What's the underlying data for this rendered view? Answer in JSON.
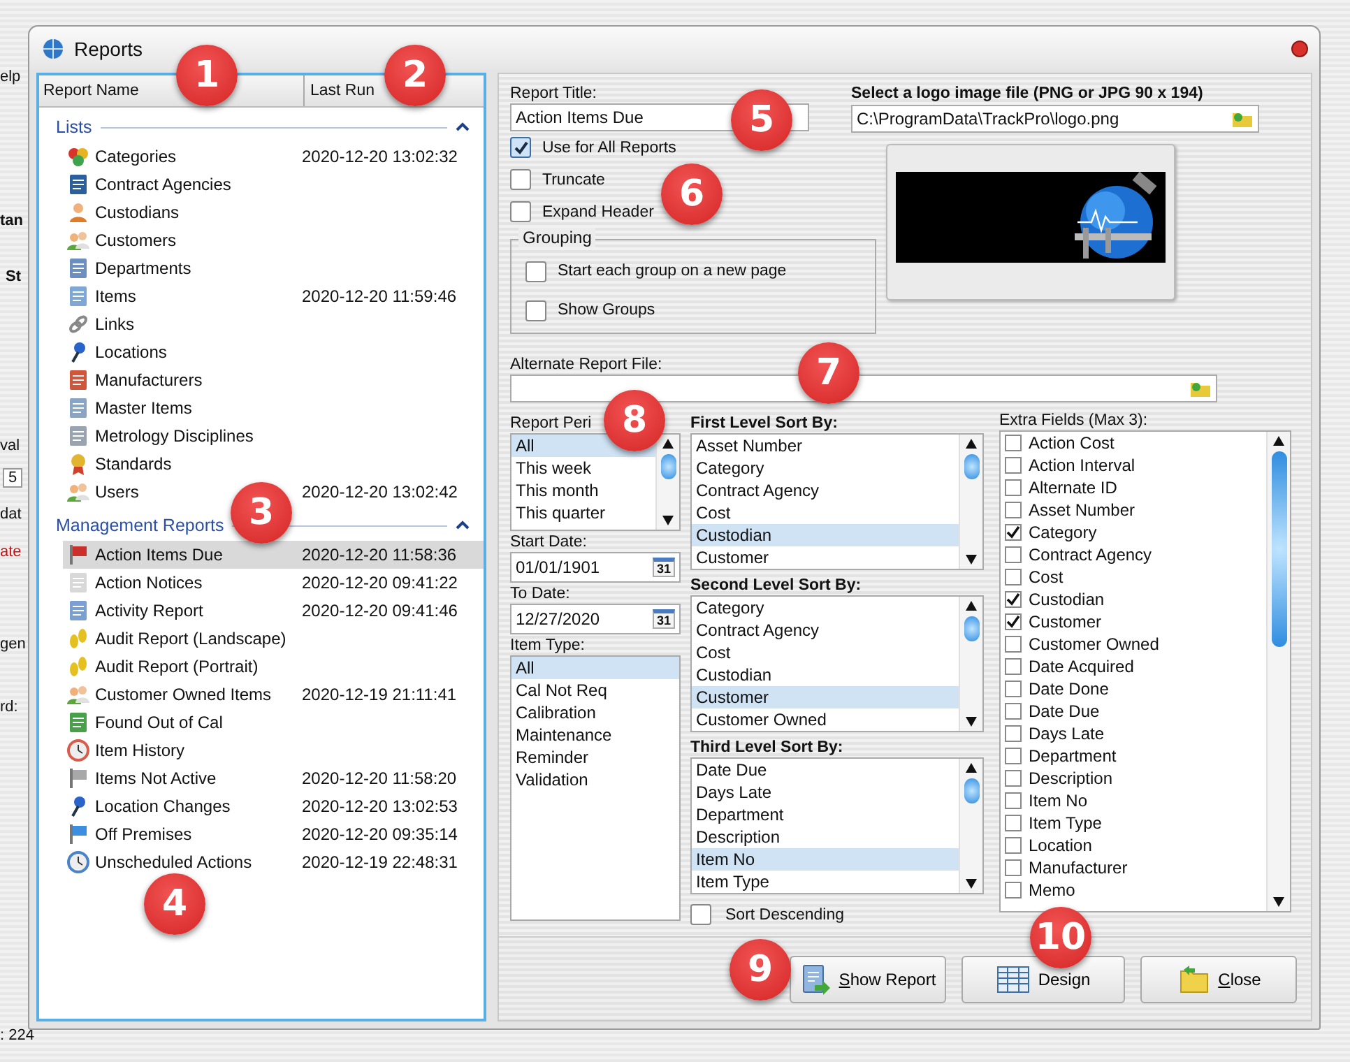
{
  "background": {
    "fragments": [
      {
        "text": "elp",
        "kind": "menu"
      },
      {
        "text": "tan",
        "kind": "heading"
      },
      {
        "text": "St",
        "kind": "heading"
      },
      {
        "text": "val",
        "kind": "label"
      },
      {
        "text": "5",
        "kind": "value"
      },
      {
        "text": "dat",
        "kind": "label"
      },
      {
        "text": "ate",
        "kind": "alert"
      },
      {
        "text": "gen",
        "kind": "label"
      },
      {
        "text": "rd:",
        "kind": "label"
      },
      {
        "text": ": 224",
        "kind": "status"
      }
    ]
  },
  "window": {
    "title": "Reports"
  },
  "report_list": {
    "columns": [
      "Report Name",
      "Last Run"
    ],
    "groups": [
      {
        "title": "Lists",
        "expanded": true,
        "items": [
          {
            "name": "Categories",
            "last_run": "2020-12-20 13:02:32",
            "selected": false
          },
          {
            "name": "Contract Agencies",
            "selected": false
          },
          {
            "name": "Custodians",
            "selected": false
          },
          {
            "name": "Customers",
            "selected": false
          },
          {
            "name": "Departments",
            "selected": false
          },
          {
            "name": "Items",
            "last_run": "2020-12-20 11:59:46",
            "selected": false
          },
          {
            "name": "Links",
            "selected": false
          },
          {
            "name": "Locations",
            "selected": false
          },
          {
            "name": "Manufacturers",
            "selected": false
          },
          {
            "name": "Master Items",
            "selected": false
          },
          {
            "name": "Metrology Disciplines",
            "selected": false
          },
          {
            "name": "Standards",
            "selected": false
          },
          {
            "name": "Users",
            "last_run": "2020-12-20 13:02:42",
            "selected": false
          }
        ]
      },
      {
        "title": "Management Reports",
        "expanded": true,
        "items": [
          {
            "name": "Action Items Due",
            "last_run": "2020-12-20 11:58:36",
            "selected": true
          },
          {
            "name": "Action Notices",
            "last_run": "2020-12-20 09:41:22",
            "selected": false
          },
          {
            "name": "Activity Report",
            "last_run": "2020-12-20 09:41:46",
            "selected": false
          },
          {
            "name": "Audit Report (Landscape)",
            "selected": false
          },
          {
            "name": "Audit Report (Portrait)",
            "selected": false
          },
          {
            "name": "Customer Owned Items",
            "last_run": "2020-12-19 21:11:41",
            "selected": false
          },
          {
            "name": "Found Out of Cal",
            "selected": false
          },
          {
            "name": "Item History",
            "selected": false
          },
          {
            "name": "Items Not Active",
            "last_run": "2020-12-20 11:58:20",
            "selected": false
          },
          {
            "name": "Location Changes",
            "last_run": "2020-12-20 13:02:53",
            "selected": false
          },
          {
            "name": "Off Premises",
            "last_run": "2020-12-20 09:35:14",
            "selected": false
          },
          {
            "name": "Unscheduled Actions",
            "last_run": "2020-12-19 22:48:31",
            "selected": false
          }
        ]
      }
    ]
  },
  "report_title": {
    "label": "Report Title:",
    "value": "Action Items Due"
  },
  "options": [
    {
      "label": "Use for All Reports",
      "checked": true
    },
    {
      "label": "Truncate",
      "checked": false
    },
    {
      "label": "Expand Header",
      "checked": false
    }
  ],
  "grouping": {
    "title": "Grouping",
    "options": [
      {
        "label": "Start each group on a new page",
        "checked": false
      },
      {
        "label": "Show Groups",
        "checked": false
      }
    ]
  },
  "logo": {
    "label": "Select a logo image file (PNG or JPG 90 x 194)",
    "path": "C:\\ProgramData\\TrackPro\\logo.png"
  },
  "alternate_report_file": {
    "label": "Alternate Report File:"
  },
  "report_period": {
    "label": "Report Peri",
    "items": [
      {
        "text": "All",
        "selected": true
      },
      {
        "text": "This week",
        "selected": false
      },
      {
        "text": "This month",
        "selected": false
      },
      {
        "text": "This quarter",
        "selected": false
      }
    ]
  },
  "dates": [
    {
      "label": "Start Date:",
      "value": "01/01/1901",
      "calendar": "31"
    },
    {
      "label": "To Date:",
      "value": "12/27/2020",
      "calendar": "31"
    }
  ],
  "item_type": {
    "label": "Item Type:",
    "items": [
      {
        "text": "All",
        "selected": true
      },
      {
        "text": "Cal Not Req",
        "selected": false
      },
      {
        "text": "Calibration",
        "selected": false
      },
      {
        "text": "Maintenance",
        "selected": false
      },
      {
        "text": "Reminder",
        "selected": false
      },
      {
        "text": "Validation",
        "selected": false
      }
    ]
  },
  "sorts": [
    {
      "label": "First Level Sort By:",
      "items": [
        {
          "text": "Asset Number",
          "selected": false
        },
        {
          "text": "Category",
          "selected": false
        },
        {
          "text": "Contract Agency",
          "selected": false
        },
        {
          "text": "Cost",
          "selected": false
        },
        {
          "text": "Custodian",
          "selected": true
        },
        {
          "text": "Customer",
          "selected": false
        }
      ]
    },
    {
      "label": "Second Level Sort By:",
      "items": [
        {
          "text": "Category",
          "selected": false
        },
        {
          "text": "Contract Agency",
          "selected": false
        },
        {
          "text": "Cost",
          "selected": false
        },
        {
          "text": "Custodian",
          "selected": false
        },
        {
          "text": "Customer",
          "selected": true
        },
        {
          "text": "Customer Owned",
          "selected": false
        }
      ]
    },
    {
      "label": "Third Level Sort By:",
      "items": [
        {
          "text": "Date Due",
          "selected": false
        },
        {
          "text": "Days Late",
          "selected": false
        },
        {
          "text": "Department",
          "selected": false
        },
        {
          "text": "Description",
          "selected": false
        },
        {
          "text": "Item No",
          "selected": true
        },
        {
          "text": "Item Type",
          "selected": false
        }
      ]
    }
  ],
  "sort_descending": {
    "label": "Sort Descending",
    "checked": false
  },
  "extra_fields": {
    "label": "Extra Fields (Max 3):",
    "items": [
      {
        "text": "Action Cost",
        "checked": false
      },
      {
        "text": "Action Interval",
        "checked": false
      },
      {
        "text": "Alternate ID",
        "checked": false
      },
      {
        "text": "Asset Number",
        "checked": false
      },
      {
        "text": "Category",
        "checked": true
      },
      {
        "text": "Contract Agency",
        "checked": false
      },
      {
        "text": "Cost",
        "checked": false
      },
      {
        "text": "Custodian",
        "checked": true
      },
      {
        "text": "Customer",
        "checked": true
      },
      {
        "text": "Customer Owned",
        "checked": false
      },
      {
        "text": "Date Acquired",
        "checked": false
      },
      {
        "text": "Date Done",
        "checked": false
      },
      {
        "text": "Date Due",
        "checked": false
      },
      {
        "text": "Days Late",
        "checked": false
      },
      {
        "text": "Department",
        "checked": false
      },
      {
        "text": "Description",
        "checked": false
      },
      {
        "text": "Item No",
        "checked": false
      },
      {
        "text": "Item Type",
        "checked": false
      },
      {
        "text": "Location",
        "checked": false
      },
      {
        "text": "Manufacturer",
        "checked": false
      },
      {
        "text": "Memo",
        "checked": false
      }
    ]
  },
  "buttons": [
    {
      "label": "Show Report",
      "kind": "show",
      "underline_first": true
    },
    {
      "label": "Design",
      "kind": "design",
      "underline_first": false
    },
    {
      "label": "Close",
      "kind": "close",
      "underline_first": true
    }
  ],
  "callouts": [
    "1",
    "2",
    "3",
    "4",
    "5",
    "6",
    "7",
    "8",
    "9",
    "10"
  ]
}
